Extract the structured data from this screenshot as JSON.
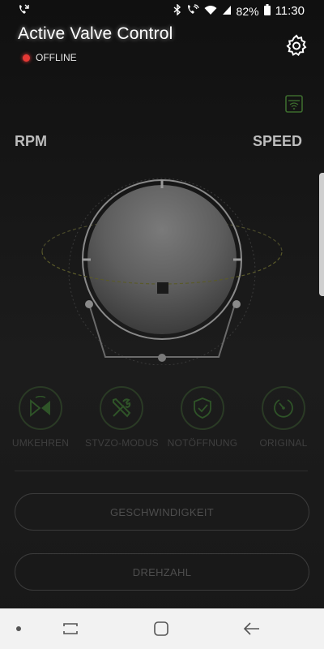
{
  "status_bar": {
    "battery_percent": "82%",
    "time": "11:30",
    "icons": [
      "missed-call-icon",
      "bluetooth-icon",
      "wifi-calling-icon",
      "wifi-icon",
      "signal-icon",
      "battery-icon"
    ]
  },
  "header": {
    "title": "Active Valve Control",
    "connection_status": "OFFLINE",
    "status_color": "#e53935"
  },
  "gauge": {
    "left_label": "RPM",
    "right_label": "SPEED"
  },
  "actions": [
    {
      "label": "UMKEHREN",
      "icon": "reverse-icon"
    },
    {
      "label": "STVZO-MODUS",
      "icon": "tools-icon"
    },
    {
      "label": "NOTÖFFNUNG",
      "icon": "shield-check-icon"
    },
    {
      "label": "ORIGINAL",
      "icon": "gauge-dial-icon"
    }
  ],
  "buttons": {
    "speed": "GESCHWINDIGKEIT",
    "rpm": "DREHZAHL"
  },
  "colors": {
    "accent_green": "#3c6b2d",
    "offline_red": "#e53935"
  }
}
